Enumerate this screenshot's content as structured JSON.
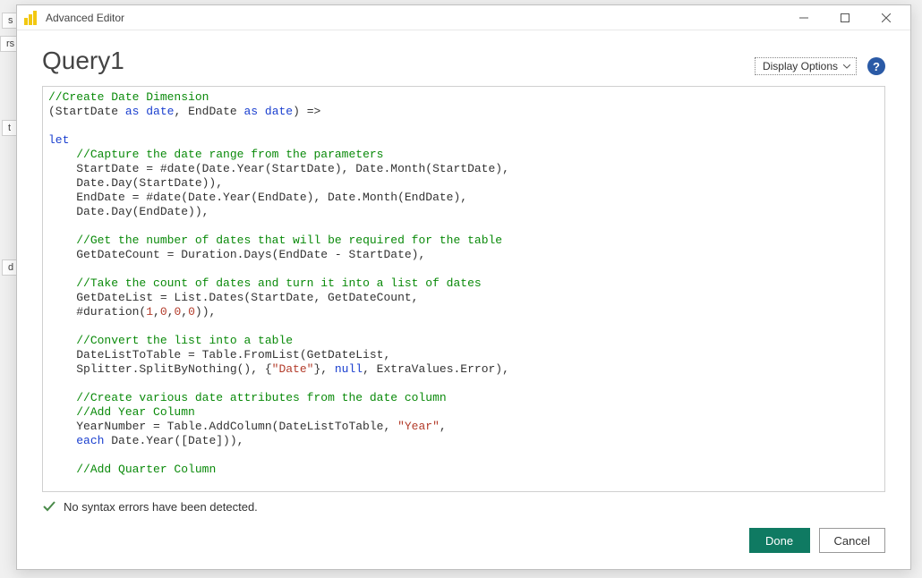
{
  "background": {
    "frag1": "s",
    "frag2": "rs",
    "frag3": "t",
    "frag4": "d"
  },
  "titlebar": {
    "title": "Advanced Editor"
  },
  "header": {
    "query_title": "Query1",
    "display_options_label": "Display Options",
    "help_tooltip": "?"
  },
  "code": {
    "tokens": [
      {
        "cls": "c-comment",
        "text": "//Create Date Dimension"
      },
      {
        "text": "\n(StartDate "
      },
      {
        "cls": "c-keyword",
        "text": "as"
      },
      {
        "text": " "
      },
      {
        "cls": "c-keyword",
        "text": "date"
      },
      {
        "text": ", EndDate "
      },
      {
        "cls": "c-keyword",
        "text": "as"
      },
      {
        "text": " "
      },
      {
        "cls": "c-keyword",
        "text": "date"
      },
      {
        "text": ") =>\n\n"
      },
      {
        "cls": "c-keyword",
        "text": "let"
      },
      {
        "text": "\n    "
      },
      {
        "cls": "c-comment",
        "text": "//Capture the date range from the parameters"
      },
      {
        "text": "\n    StartDate = #date(Date.Year(StartDate), Date.Month(StartDate),\n    Date.Day(StartDate)),\n    EndDate = #date(Date.Year(EndDate), Date.Month(EndDate),\n    Date.Day(EndDate)),\n\n    "
      },
      {
        "cls": "c-comment",
        "text": "//Get the number of dates that will be required for the table"
      },
      {
        "text": "\n    GetDateCount = Duration.Days(EndDate - StartDate),\n\n    "
      },
      {
        "cls": "c-comment",
        "text": "//Take the count of dates and turn it into a list of dates"
      },
      {
        "text": "\n    GetDateList = List.Dates(StartDate, GetDateCount,\n    #duration("
      },
      {
        "cls": "c-number",
        "text": "1"
      },
      {
        "text": ","
      },
      {
        "cls": "c-number",
        "text": "0"
      },
      {
        "text": ","
      },
      {
        "cls": "c-number",
        "text": "0"
      },
      {
        "text": ","
      },
      {
        "cls": "c-number",
        "text": "0"
      },
      {
        "text": ")),\n\n    "
      },
      {
        "cls": "c-comment",
        "text": "//Convert the list into a table"
      },
      {
        "text": "\n    DateListToTable = Table.FromList(GetDateList,\n    Splitter.SplitByNothing(), {"
      },
      {
        "cls": "c-string",
        "text": "\"Date\""
      },
      {
        "text": "}, "
      },
      {
        "cls": "c-null",
        "text": "null"
      },
      {
        "text": ", ExtraValues.Error),\n\n    "
      },
      {
        "cls": "c-comment",
        "text": "//Create various date attributes from the date column"
      },
      {
        "text": "\n    "
      },
      {
        "cls": "c-comment",
        "text": "//Add Year Column"
      },
      {
        "text": "\n    YearNumber = Table.AddColumn(DateListToTable, "
      },
      {
        "cls": "c-string",
        "text": "\"Year\""
      },
      {
        "text": ",\n    "
      },
      {
        "cls": "c-keyword",
        "text": "each"
      },
      {
        "text": " Date.Year([Date])),\n\n    "
      },
      {
        "cls": "c-comment",
        "text": "//Add Quarter Column"
      },
      {
        "text": "\n"
      }
    ]
  },
  "status": {
    "message": "No syntax errors have been detected."
  },
  "buttons": {
    "done": "Done",
    "cancel": "Cancel"
  }
}
